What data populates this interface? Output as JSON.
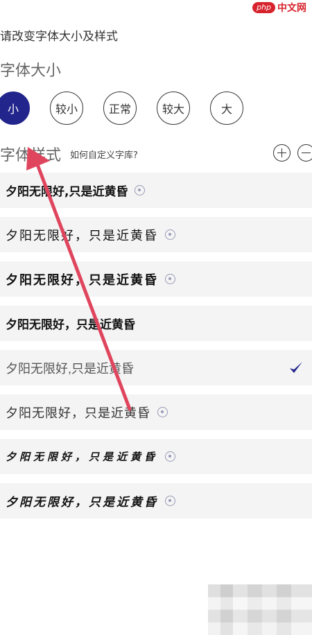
{
  "watermark": {
    "logo": "php",
    "text": "中文网"
  },
  "header": {
    "title": "请改变字体大小及样式"
  },
  "font_size": {
    "title": "字体大小",
    "options": [
      "小",
      "较小",
      "正常",
      "较大",
      "大"
    ],
    "selected": "小"
  },
  "font_style": {
    "title": "字体样式",
    "custom_link": "如何自定义字库?",
    "add_icon": "plus-circle-icon",
    "remove_icon": "minus-circle-icon",
    "items": [
      {
        "sample": "夕阳无限好,只是近黄昏",
        "downloadable": true,
        "selected": false
      },
      {
        "sample": "夕阳无限好，只是近黄昏",
        "downloadable": true,
        "selected": false
      },
      {
        "sample": "夕阳无限好，只是近黄昏",
        "downloadable": true,
        "selected": false
      },
      {
        "sample": "夕阳无限好，只是近黄昏",
        "downloadable": false,
        "selected": false
      },
      {
        "sample": "夕阳无限好,只是近黄昏",
        "downloadable": false,
        "selected": true
      },
      {
        "sample": "夕阳无限好，只是近黄昏",
        "downloadable": true,
        "selected": false
      },
      {
        "sample": "夕阳无限好，只是近黄昏",
        "downloadable": true,
        "selected": false
      },
      {
        "sample": "夕阳无限好，只是近黄昏",
        "downloadable": true,
        "selected": false
      }
    ]
  },
  "colors": {
    "accent": "#21258c",
    "annotation_arrow": "#e0455e"
  }
}
